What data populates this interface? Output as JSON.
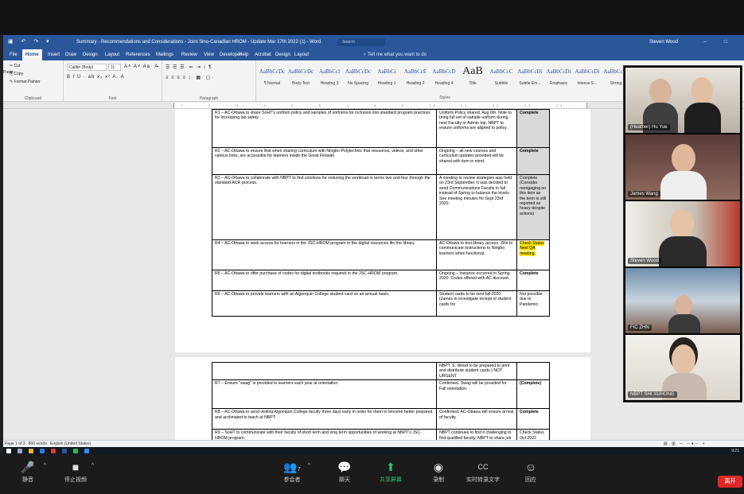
{
  "word": {
    "qat_icons": "▣ ↶ ↷ ▾",
    "doc_title": "Summary - Recommendations and Considerations - Joint Sino-Canadian HROM - Update Mar 17th 2022 (1) - Word",
    "search_label": "Search",
    "user_name": "Steven Wood",
    "window_controls": "─ □ ✕",
    "menu_tabs": [
      "File",
      "Home",
      "Insert",
      "Draw",
      "Design",
      "Layout",
      "References",
      "Mailings",
      "Review",
      "View",
      "Developer",
      "Help",
      "Acrobat",
      "Design",
      "Layout"
    ],
    "tell_me": "♀ Tell me what you want to do",
    "clipboard": {
      "paste": "Paste",
      "cut": "✂ Cut",
      "copy": "⎘ Copy",
      "format_painter": "✎ Format Painter",
      "label": "Clipboard"
    },
    "font": {
      "name": "Calibri (Body)",
      "size": "11",
      "tools_row1": "A˄ A˅ Aa· A̶",
      "tools_row2": "B I U · ab x₂ x² A· A",
      "label": "Font"
    },
    "paragraph": {
      "tools_row1": "☰ ☰ ☰· ⇤ ⇥ ↕ ¶",
      "tools_row2": "≡ ≡ ≡ ≡ ↕· ▦· ▢·",
      "label": "Paragraph"
    },
    "styles": [
      {
        "preview": "AaBbCcDc",
        "name": "¶ Normal"
      },
      {
        "preview": "AaBbCcDc",
        "name": "Body Text"
      },
      {
        "preview": "AaBbCcl",
        "name": "Heading 3"
      },
      {
        "preview": "AaBbCcDc",
        "name": "No Spacing"
      },
      {
        "preview": "AaBbCi",
        "name": "Heading 1"
      },
      {
        "preview": "AaBbCcE",
        "name": "Heading 2"
      },
      {
        "preview": "AaBbCcD",
        "name": "Heading 4"
      },
      {
        "preview": "AaB",
        "name": "Title"
      },
      {
        "preview": "AaBbCcC",
        "name": "Subtitle"
      },
      {
        "preview": "AaBbCcDi",
        "name": "Subtle Em..."
      },
      {
        "preview": "AaBbCcDi",
        "name": "Emphasis"
      },
      {
        "preview": "AaBbCcDi",
        "name": "Intense E..."
      },
      {
        "preview": "AaBbCcDi",
        "name": "Strong"
      }
    ],
    "styles_label": "Styles",
    "ruler_text": "· 1 · · · 2 · · · 3 · · · 4 · · · 5 · · · 6 · · · 7 · · · 8 · · · 9 · · · 10 · · · 11 · · · 12 · · · 13 · · · 14 · · · 15 · · · 16 · · · 17 · · · 18 · · · 19 ·",
    "table_page1": [
      {
        "c1": "R1 – AC-Ottawa to share SoHT's uniform policy and samples of uniforms for inclusion into standard program practices for increasing lab safety.",
        "c2": "Uniform Policy shared, Aug 6th. Note to bring full set of sample uniform during next Faculty or Admin trip. NBPT to ensure uniforms are aligned to policy.",
        "c3": "Complete",
        "shade": true,
        "hl": false
      },
      {
        "c1": "R2 – AC-Ottawa to ensure that when sharing curriculum with Ningbo-Polytechnic that resources, videos, and other various links, are accessible for learners inside the Great Firewall.",
        "c2": "Ongoing – all new courses and curriculum updates provided will be shared with item in mind.",
        "c3": "Complete",
        "shade": true,
        "hl": false
      },
      {
        "c1": "R3 – AC-Ottawa to collaborate with NBPT to find solutions for reducing the workload in terms two and four through the standard ACR process.",
        "c2": "A meeting to review strategies was held on 23rd September. It was decided to send Communications Faculty in fall instead of Spring to balance the levels. See meeting minutes for Sept 23rd 2020.",
        "c3": "Complete (Consider reengaging on this item as the term is still reported as heavy despite actions)",
        "shade": true,
        "hl": false
      },
      {
        "c1": "R4 – AC-Ottawa to seek access for learners in the JSC-HROM program to the digital resources ifin the library.",
        "c2": "AC-Ottawa to test library access. Zilin to communicate instructions to Ningbo learners when functional.",
        "c3": "Check Status Next QA meeting.",
        "shade": false,
        "hl": true
      },
      {
        "c1": "R5 – AC-Ottawa to offer purchase of codes for digital textbooks required in the JSC-HROM program.",
        "c2": "Ongoing – Instance occurred in Spring 2020. Codes offered with AC discount.",
        "c3": "Complete",
        "shade": false,
        "hl": false
      },
      {
        "c1": "R6 – AC-Ottawa to provide learners with an Algonquin College student card on an annual basis.",
        "c2": "Student cards to be sent fall 2020 (James to investigate receipt of student cards for",
        "c3": "Not possible due to Pandemic.",
        "shade": false,
        "hl": false
      }
    ],
    "table_page2": [
      {
        "c1": "",
        "c2": "NBPT. S. Wood to be prepared to print and distribute student cards.) NOT URGENT",
        "c3": "",
        "shade": false,
        "hl": false
      },
      {
        "c1": "R7 – Ensure \"swag\" is provided to learners each year at orientation.",
        "c2": "Confirmed. Swag will be provided for Fall orientation.",
        "c3": "(Complete)",
        "shade": false,
        "hl": false
      },
      {
        "c1": "R8 – AC-Ottawa to send visiting Algonquin College faculty three days early in order for them to become better prepared and acclimated to teach at NBPT.",
        "c2": "Confirmed. AC-Ottawa will ensure arrival of faculty.",
        "c3": "Complete",
        "shade": false,
        "hl": false
      },
      {
        "c1": "R9 – SoHT to communicate with their faculty of short term and long term opportunities of working at NBPT's JSC-HROM program.",
        "c2": "NBPT continues to find it challenging to find qualified faculty. NBPT to share job description. AC to reach out to SoHT and share with part time faculty.",
        "c3": "Check Status Oct 2022 (Paused due to travel restrictions)",
        "shade": false,
        "hl": false
      }
    ],
    "status": {
      "page": "Page 1 of 3",
      "words": "800 words",
      "lang": "English (United States)",
      "zoom_tools": "▤ ▥ ─ ─●─ +"
    },
    "clock": "9:21"
  },
  "participants": [
    {
      "name": "(Heather) Hu Yue"
    },
    {
      "name": "James Wang"
    },
    {
      "name": "Steven Wood"
    },
    {
      "name": "FIC ZHN"
    },
    {
      "name": "NBPT SHI XUHONG"
    }
  ],
  "zoom": {
    "buttons": [
      {
        "icon": "🎤",
        "label": "静音"
      },
      {
        "icon": "■",
        "label": "停止视频"
      },
      {
        "icon": "👥",
        "label": "参会者",
        "count": "7"
      },
      {
        "icon": "💬",
        "label": "聊天"
      },
      {
        "icon": "⬆",
        "label": "共享屏幕"
      },
      {
        "icon": "◉",
        "label": "录制"
      },
      {
        "icon": "CC",
        "label": "实时转录文字"
      },
      {
        "icon": "☺",
        "label": "回应"
      }
    ],
    "end_label": "离开"
  }
}
